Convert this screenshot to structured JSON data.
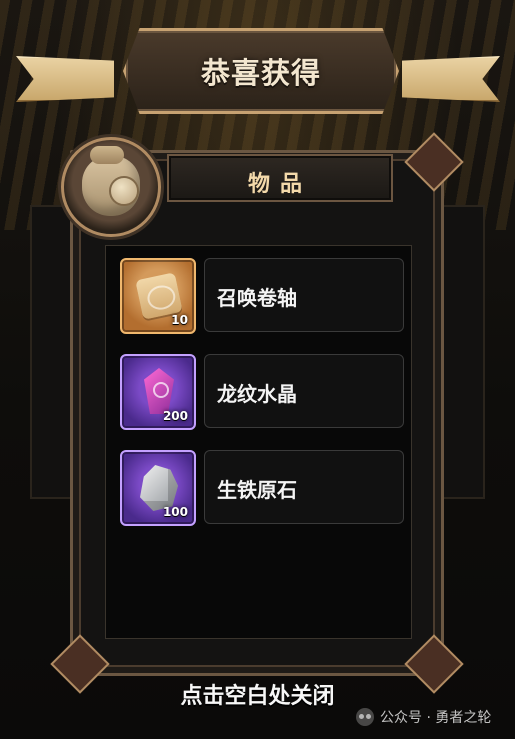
{
  "header": {
    "title": "恭喜获得"
  },
  "panel": {
    "category": "物品"
  },
  "items": [
    {
      "name": "召唤卷轴",
      "qty": "10",
      "icon": "summon-scroll-icon",
      "frame": "orange"
    },
    {
      "name": "龙纹水晶",
      "qty": "200",
      "icon": "dragon-crystal-icon",
      "frame": "purple"
    },
    {
      "name": "生铁原石",
      "qty": "100",
      "icon": "iron-ore-icon",
      "frame": "purple"
    }
  ],
  "footer": {
    "hint": "点击空白处关闭"
  },
  "watermark": {
    "text": "公众号 · 勇者之轮"
  },
  "colors": {
    "gold_border": "#b08b62",
    "rare_orange": "#f0b86e",
    "epic_purple": "#c4a1ff"
  }
}
